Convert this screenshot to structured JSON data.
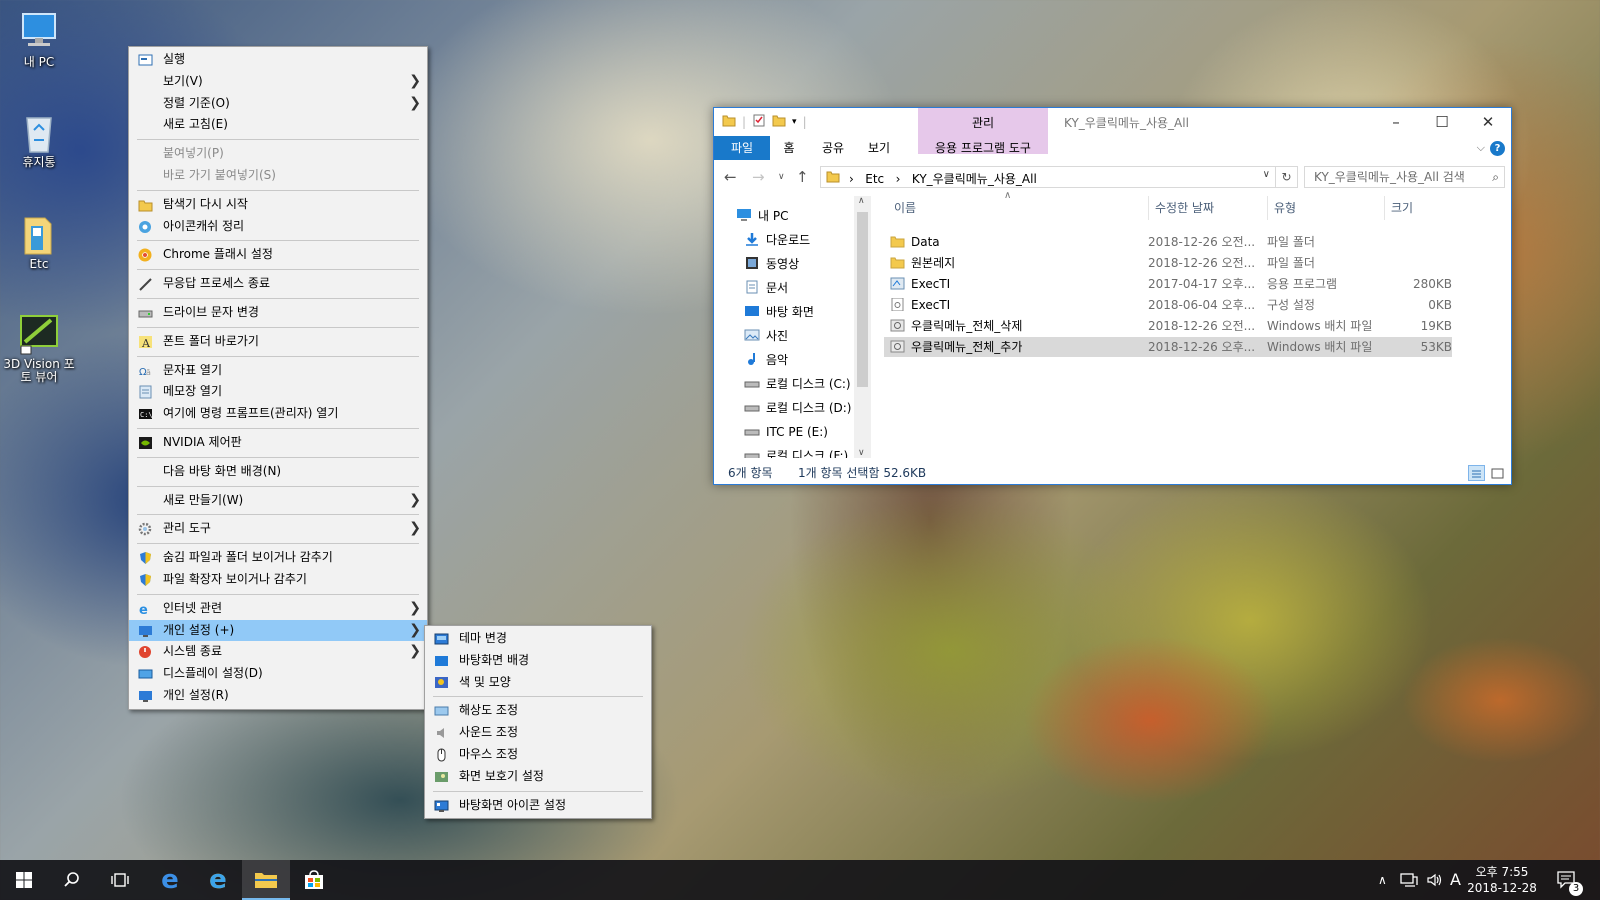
{
  "desktop": {
    "icons": [
      {
        "label": "내 PC",
        "icon": "my-pc-icon"
      },
      {
        "label": "휴지통",
        "icon": "recycle-bin-icon"
      },
      {
        "label": "Etc",
        "icon": "folder-icon"
      },
      {
        "label": "3D Vision 포토 뷰어",
        "icon": "3d-vision-icon"
      }
    ]
  },
  "context_menu": {
    "items": [
      {
        "label": "실행",
        "icon": "run-icon"
      },
      {
        "label": "보기(V)",
        "submenu": true
      },
      {
        "label": "정렬 기준(O)",
        "submenu": true
      },
      {
        "label": "새로 고침(E)"
      },
      {
        "label": "붙여넣기(P)",
        "disabled": true
      },
      {
        "label": "바로 가기 붙여넣기(S)",
        "disabled": true
      },
      {
        "label": "탐색기 다시 시작",
        "icon": "explorer-icon"
      },
      {
        "label": "아이콘캐쉬 정리",
        "icon": "icon-cache-icon"
      },
      {
        "label": "Chrome 플래시 설정",
        "icon": "chrome-icon"
      },
      {
        "label": "무응답 프로세스 종료",
        "icon": "kill-process-icon"
      },
      {
        "label": "드라이브 문자 변경",
        "icon": "drive-icon"
      },
      {
        "label": "폰트 폴더 바로가기",
        "icon": "font-folder-icon"
      },
      {
        "label": "문자표 열기",
        "icon": "charmap-icon"
      },
      {
        "label": "메모장 열기",
        "icon": "notepad-icon"
      },
      {
        "label": "여기에 명령 프롬프트(관리자) 열기",
        "icon": "cmd-icon"
      },
      {
        "label": "NVIDIA 제어판",
        "icon": "nvidia-icon"
      },
      {
        "label": "다음 바탕 화면 배경(N)"
      },
      {
        "label": "새로 만들기(W)",
        "submenu": true
      },
      {
        "label": "관리 도구",
        "icon": "admin-tools-icon",
        "submenu": true
      },
      {
        "label": "숨김 파일과 폴더 보이거나 감추기",
        "icon": "shield-icon"
      },
      {
        "label": "파일 확장자 보이거나 감추기",
        "icon": "shield-icon"
      },
      {
        "label": "인터넷 관련",
        "icon": "ie-icon",
        "submenu": true
      },
      {
        "label": "개인 설정 (+)",
        "icon": "personalize-icon",
        "submenu": true,
        "highlighted": true
      },
      {
        "label": "시스템 종료",
        "icon": "power-icon",
        "submenu": true
      },
      {
        "label": "디스플레이 설정(D)",
        "icon": "display-icon"
      },
      {
        "label": "개인 설정(R)",
        "icon": "personalize-icon"
      }
    ]
  },
  "submenu": {
    "items": [
      {
        "label": "테마 변경",
        "icon": "theme-icon"
      },
      {
        "label": "바탕화면 배경",
        "icon": "wallpaper-icon"
      },
      {
        "label": "색 및 모양",
        "icon": "color-icon"
      },
      {
        "label": "해상도 조정",
        "icon": "resolution-icon"
      },
      {
        "label": "사운드 조정",
        "icon": "sound-icon"
      },
      {
        "label": "마우스 조정",
        "icon": "mouse-icon"
      },
      {
        "label": "화면 보호기 설정",
        "icon": "screensaver-icon"
      },
      {
        "label": "바탕화면 아이콘 설정",
        "icon": "desktop-icons-icon"
      }
    ]
  },
  "explorer": {
    "manage_tab": "관리",
    "title": "KY_우클릭메뉴_사용_All",
    "ribbon_tabs": [
      "파일",
      "홈",
      "공유",
      "보기",
      "응용 프로그램 도구"
    ],
    "address": {
      "segments": [
        "Etc",
        "KY_우클릭메뉴_사용_All"
      ]
    },
    "search_placeholder": "KY_우클릭메뉴_사용_All 검색",
    "nav_items": [
      {
        "label": "내 PC",
        "icon": "my-pc-icon"
      },
      {
        "label": "다운로드",
        "icon": "download-icon"
      },
      {
        "label": "동영상",
        "icon": "video-icon"
      },
      {
        "label": "문서",
        "icon": "document-icon"
      },
      {
        "label": "바탕 화면",
        "icon": "desktop-icon"
      },
      {
        "label": "사진",
        "icon": "pictures-icon"
      },
      {
        "label": "음악",
        "icon": "music-icon"
      },
      {
        "label": "로컬 디스크 (C:)",
        "icon": "disk-icon"
      },
      {
        "label": "로컬 디스크 (D:)",
        "icon": "disk-icon"
      },
      {
        "label": "ITC PE (E:)",
        "icon": "disk-icon"
      },
      {
        "label": "로컬 디스크 (F:)",
        "icon": "disk-icon"
      }
    ],
    "columns": [
      "이름",
      "수정한 날짜",
      "유형",
      "크기"
    ],
    "files": [
      {
        "name": "Data",
        "date": "2018-12-26 오전...",
        "type": "파일 폴더",
        "size": "",
        "icon": "folder-icon"
      },
      {
        "name": "원본레지",
        "date": "2018-12-26 오전...",
        "type": "파일 폴더",
        "size": "",
        "icon": "folder-icon"
      },
      {
        "name": "ExecTI",
        "date": "2017-04-17 오후...",
        "type": "응용 프로그램",
        "size": "280KB",
        "icon": "app-icon"
      },
      {
        "name": "ExecTI",
        "date": "2018-06-04 오후...",
        "type": "구성 설정",
        "size": "0KB",
        "icon": "config-icon"
      },
      {
        "name": "우클릭메뉴_전체_삭제",
        "date": "2018-12-26 오전...",
        "type": "Windows 배치 파일",
        "size": "19KB",
        "icon": "batch-icon"
      },
      {
        "name": "우클릭메뉴_전체_추가",
        "date": "2018-12-26 오후...",
        "type": "Windows 배치 파일",
        "size": "53KB",
        "icon": "batch-icon",
        "selected": true
      }
    ],
    "status_count": "6개 항목",
    "status_selection": "1개 항목 선택함 52.6KB"
  },
  "taskbar": {
    "time": "오후 7:55",
    "date": "2018-12-28",
    "ime": "A",
    "notification_count": "3"
  }
}
